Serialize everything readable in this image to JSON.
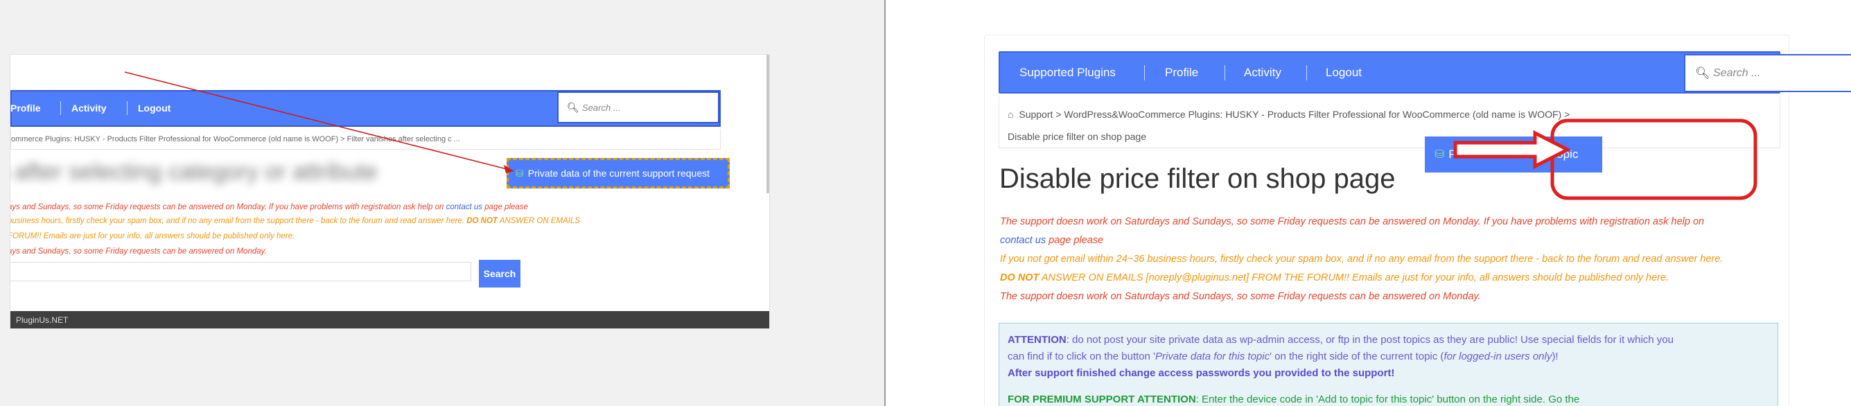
{
  "left": {
    "nav": [
      "Profile",
      "Activity",
      "Logout"
    ],
    "search_placeholder": "Search ...",
    "breadcrumb": "ommerce Plugins: HUSKY - Products Filter Professional for WooCommerce (old name is WOOF) > Filter vanishes after selecting c ...",
    "title_blurred": "s after selecting category or attribute",
    "private_button": "Private data of the current support request",
    "notice": {
      "line1": "ays and Sundays, so some Friday requests can be answered on Monday. If you have problems with registration ask help on",
      "contact": "contact us",
      "line1_tail": "page please",
      "line2_pre": "business hours, firstly check your spam box, and if no any email from the support there - back to the forum and read answer here.",
      "do_not": "DO NOT",
      "line2_tail": "ANSWER ON EMAILS",
      "line3": "FORUM!! Emails are just for your info, all answers should be published only here.",
      "line4": "ays and Sundays, so some Friday requests can be answered on Monday."
    },
    "search_button": "Search",
    "footer": "PluginUs.NET"
  },
  "right": {
    "nav": [
      "Supported Plugins",
      "Profile",
      "Activity",
      "Logout"
    ],
    "search_placeholder": "Search ...",
    "breadcrumb": {
      "home": "Support",
      "forum": "WordPress&WooCommerce Plugins: HUSKY - Products Filter Professional for WooCommerce (old name is WOOF)",
      "topic": "Disable price filter on shop page"
    },
    "private_button": "Private data for this topic",
    "title": "Disable price filter on shop page",
    "notice": {
      "line1": "The support doesn work on Saturdays and Sundays, so some Friday requests can be answered on Monday. If you have problems with registration ask help on",
      "contact": "contact us",
      "line2_tail": "page please",
      "line3": "If you not got email within 24~36 business hours, firstly check your spam box, and if no any email from the support there - back to the forum and read answer here.",
      "do_not": "DO NOT",
      "line4_tail": "ANSWER ON EMAILS [noreply@pluginus.net] FROM THE FORUM!! Emails are just for your info, all answers should be published only here.",
      "line5": "The support doesn work on Saturdays and Sundays, so some Friday requests can be answered on Monday."
    },
    "attention": {
      "label": "ATTENTION",
      "text1": ": do not post your site private data as wp-admin access, or ftp in the post topics as they are public! Use special fields for it which you",
      "text2a": "can find if to click on the button '",
      "text2_em": "Private data for this topic",
      "text2b": "' on the right side of the current topic (",
      "text2_em2": "for logged-in users only",
      "text2c": ")!",
      "bold_line": "After support finished change access passwords you provided to the support!",
      "premium_label": "FOR PREMIUM SUPPORT ATTENTION",
      "premium_text": ": Enter the device code in 'Add to topic for this topic' button on the right side. Go the"
    }
  },
  "colors": {
    "nav_blue": "#4f7efb",
    "notice_red": "#e6452b",
    "notice_orange": "#f2960c",
    "callout_red": "#e01f1f",
    "db_icon_green": "#7be38f"
  },
  "icons": [
    "search-icon",
    "home-icon",
    "database-icon",
    "arrow-annotation"
  ]
}
